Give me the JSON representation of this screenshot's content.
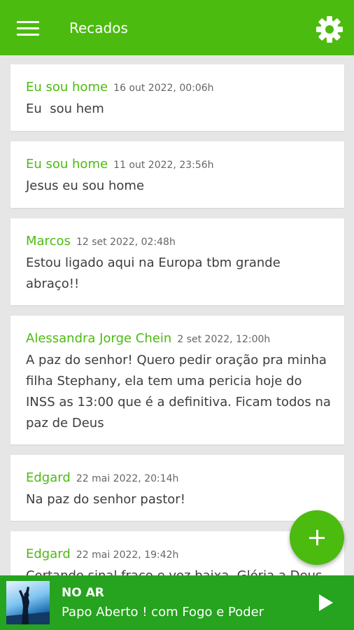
{
  "appbar": {
    "title": "Recados",
    "menu_icon": "hamburger-menu-icon",
    "settings_icon": "gear-icon",
    "color": "#4cbb0f"
  },
  "messages": [
    {
      "author": "Eu sou home",
      "date": "16 out 2022, 00:06h",
      "text": "Eu  sou hem"
    },
    {
      "author": "Eu sou home",
      "date": "11 out 2022, 23:56h",
      "text": "Jesus eu sou home"
    },
    {
      "author": "Marcos",
      "date": "12 set 2022, 02:48h",
      "text": "Estou ligado aqui na Europa tbm grande abraço!!"
    },
    {
      "author": "Alessandra Jorge Chein",
      "date": "2 set 2022, 12:00h",
      "text": "A paz do senhor! Quero pedir oração pra minha filha Stephany, ela tem uma pericia hoje do INSS as 13:00 que é a definitiva. Ficam todos na paz de Deus"
    },
    {
      "author": "Edgard",
      "date": "22 mai 2022, 20:14h",
      "text": "Na paz do senhor pastor!"
    },
    {
      "author": "Edgard",
      "date": "22 mai 2022, 19:42h",
      "text": "Cortando sinal fraco e voz baixa. Glória a Deus"
    }
  ],
  "fab": {
    "icon": "plus-icon"
  },
  "player": {
    "status": "NO AR",
    "program": "Papo Aberto ! com Fogo e Poder",
    "thumbnail": "program-thumbnail",
    "play_icon": "play-icon",
    "color": "#26a31f"
  }
}
